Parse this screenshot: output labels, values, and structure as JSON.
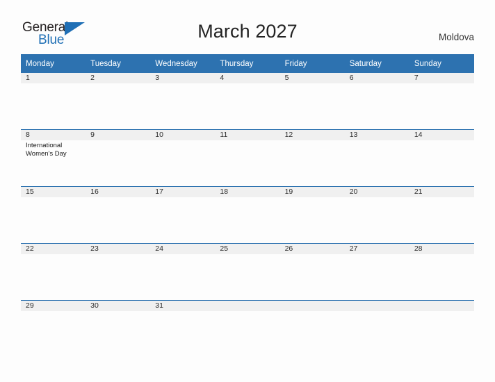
{
  "brand": {
    "name_part1": "General",
    "name_part2": "Blue",
    "flag_icon": "triangle-flag-icon",
    "color_dark": "#231f20",
    "color_blue": "#1f6fb5"
  },
  "header": {
    "title": "March 2027",
    "country": "Moldova"
  },
  "theme": {
    "header_blue": "#2d72b0",
    "row_gray": "#f0f0f0",
    "background": "#fdfdfd"
  },
  "calendar": {
    "weekday_headers": [
      "Monday",
      "Tuesday",
      "Wednesday",
      "Thursday",
      "Friday",
      "Saturday",
      "Sunday"
    ],
    "weeks": [
      {
        "days": [
          {
            "num": "1",
            "events": []
          },
          {
            "num": "2",
            "events": []
          },
          {
            "num": "3",
            "events": []
          },
          {
            "num": "4",
            "events": []
          },
          {
            "num": "5",
            "events": []
          },
          {
            "num": "6",
            "events": []
          },
          {
            "num": "7",
            "events": []
          }
        ]
      },
      {
        "days": [
          {
            "num": "8",
            "events": [
              "International Women's Day"
            ]
          },
          {
            "num": "9",
            "events": []
          },
          {
            "num": "10",
            "events": []
          },
          {
            "num": "11",
            "events": []
          },
          {
            "num": "12",
            "events": []
          },
          {
            "num": "13",
            "events": []
          },
          {
            "num": "14",
            "events": []
          }
        ]
      },
      {
        "days": [
          {
            "num": "15",
            "events": []
          },
          {
            "num": "16",
            "events": []
          },
          {
            "num": "17",
            "events": []
          },
          {
            "num": "18",
            "events": []
          },
          {
            "num": "19",
            "events": []
          },
          {
            "num": "20",
            "events": []
          },
          {
            "num": "21",
            "events": []
          }
        ]
      },
      {
        "days": [
          {
            "num": "22",
            "events": []
          },
          {
            "num": "23",
            "events": []
          },
          {
            "num": "24",
            "events": []
          },
          {
            "num": "25",
            "events": []
          },
          {
            "num": "26",
            "events": []
          },
          {
            "num": "27",
            "events": []
          },
          {
            "num": "28",
            "events": []
          }
        ]
      },
      {
        "days": [
          {
            "num": "29",
            "events": []
          },
          {
            "num": "30",
            "events": []
          },
          {
            "num": "31",
            "events": []
          },
          {
            "num": "",
            "events": []
          },
          {
            "num": "",
            "events": []
          },
          {
            "num": "",
            "events": []
          },
          {
            "num": "",
            "events": []
          }
        ]
      }
    ]
  }
}
